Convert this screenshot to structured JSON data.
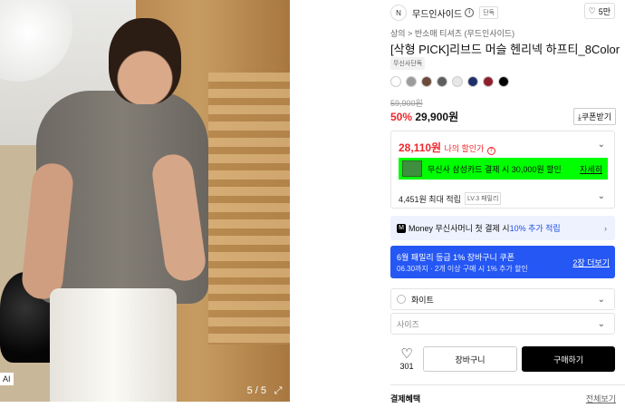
{
  "photo": {
    "counter": "5 / 5",
    "ai_tag": "AI"
  },
  "brand": {
    "logo_text": "N",
    "name": "무드인사이드",
    "badge": "단독",
    "like_count": "5만"
  },
  "breadcrumb": "상의 > 반소매 티셔츠 (무드인사이드)",
  "product": {
    "title": "[삭형 PICK]리브드 머슬 헨리넥 하프티_8Color",
    "tag": "무신사단독",
    "colors": [
      "#ffffff",
      "#9c9c9c",
      "#6b4a3a",
      "#5e5e5e",
      "#e6e6e6",
      "#1f2f6b",
      "#8e1f2a",
      "#000000"
    ],
    "original_price": "59,900원",
    "discount": "50%",
    "price": "29,900원",
    "coupon_button": "쿠폰받기"
  },
  "benefit": {
    "my_price": "28,110원",
    "my_price_label": "나의 할인가",
    "card_text": "무신사 삼성카드 결제 시 30,000원 할인",
    "card_link": "자세히",
    "points_text": "4,451원 최대 적립",
    "level_badge": "LV.3 패밀리"
  },
  "money": {
    "label": "Money",
    "text_before": "무신사머니 첫 결제 시 ",
    "text_highlight": "10% 추가 적립"
  },
  "coupon_banner": {
    "title": "6월 패밀리 등급 1% 장바구니 쿠폰",
    "subtitle": "06.30까지 · 2개 이상 구매 시 1% 추가 할인",
    "link": "2장 더보기"
  },
  "options": {
    "color_value": "화이트",
    "size_placeholder": "사이즈"
  },
  "actions": {
    "like_count": "301",
    "cart_label": "장바구니",
    "buy_label": "구매하기"
  },
  "footer": {
    "pay_benefit": "결제혜택",
    "view_all": "전체보기"
  }
}
